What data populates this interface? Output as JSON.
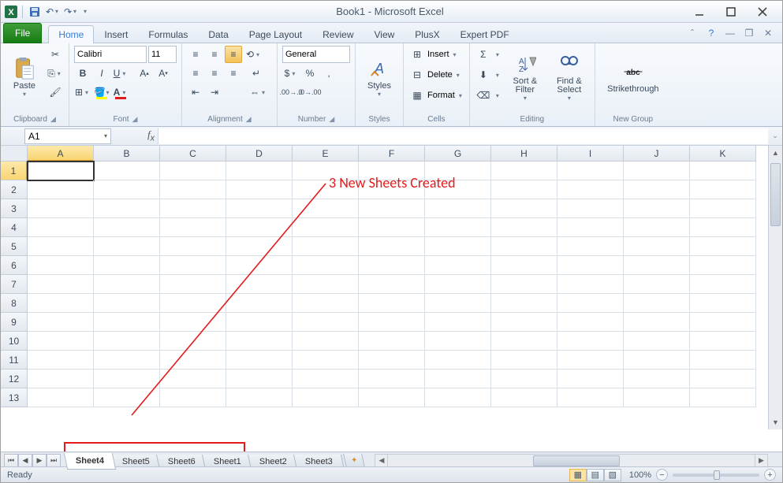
{
  "title": "Book1 - Microsoft Excel",
  "tabs": [
    "Home",
    "Insert",
    "Formulas",
    "Data",
    "Page Layout",
    "Review",
    "View",
    "PlusX",
    "Expert PDF"
  ],
  "file_label": "File",
  "ribbon": {
    "clipboard": {
      "label": "Clipboard",
      "paste": "Paste"
    },
    "font": {
      "label": "Font",
      "name": "Calibri",
      "size": "11"
    },
    "alignment": {
      "label": "Alignment"
    },
    "number": {
      "label": "Number",
      "format": "General"
    },
    "styles": {
      "label": "Styles",
      "btn": "Styles"
    },
    "cells": {
      "label": "Cells",
      "insert": "Insert",
      "delete": "Delete",
      "format": "Format"
    },
    "editing": {
      "label": "Editing",
      "sort": "Sort &",
      "sort2": "Filter",
      "find": "Find &",
      "find2": "Select"
    },
    "newgroup": {
      "label": "New Group",
      "strike": "Strikethrough"
    }
  },
  "namebox": "A1",
  "columns": [
    "A",
    "B",
    "C",
    "D",
    "E",
    "F",
    "G",
    "H",
    "I",
    "J",
    "K"
  ],
  "rows": [
    "1",
    "2",
    "3",
    "4",
    "5",
    "6",
    "7",
    "8",
    "9",
    "10",
    "11",
    "12",
    "13"
  ],
  "sheets": [
    "Sheet4",
    "Sheet5",
    "Sheet6",
    "Sheet1",
    "Sheet2",
    "Sheet3"
  ],
  "active_sheet": 0,
  "status": "Ready",
  "zoom": "100%",
  "annotation": "3 New Sheets Created"
}
